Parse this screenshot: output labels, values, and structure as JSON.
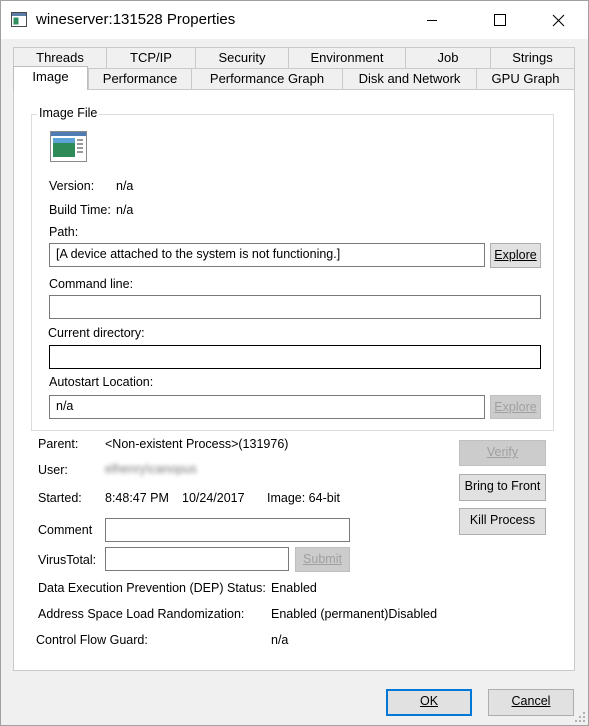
{
  "window": {
    "title": "wineserver:131528 Properties"
  },
  "tabs_row1": [
    "Threads",
    "TCP/IP",
    "Security",
    "Environment",
    "Job",
    "Strings"
  ],
  "tabs_row2": [
    "Image",
    "Performance",
    "Performance Graph",
    "Disk and Network",
    "GPU Graph"
  ],
  "selected_tab": "Image",
  "image_file": {
    "legend": "Image File",
    "version_label": "Version:",
    "version_value": "n/a",
    "build_time_label": "Build Time:",
    "build_time_value": "n/a",
    "path_label": "Path:",
    "path_value": "[A device attached to the system is not functioning.]",
    "explore_label": "Explore",
    "command_line_label": "Command line:",
    "command_line_value": "",
    "current_directory_label": "Current directory:",
    "current_directory_value": "",
    "autostart_label": "Autostart Location:",
    "autostart_value": "n/a",
    "autostart_explore_label": "Explore"
  },
  "details": {
    "parent_label": "Parent:",
    "parent_value": "<Non-existent Process>(131976)",
    "user_label": "User:",
    "user_value": "elhenry\\canopus",
    "started_label": "Started:",
    "started_time": "8:48:47 PM",
    "started_date": "10/24/2017",
    "image_bitness": "Image: 64-bit",
    "comment_label": "Comment",
    "comment_value": "",
    "virustotal_label": "VirusTotal:",
    "virustotal_value": "",
    "submit_label": "Submit",
    "dep_label": "Data Execution Prevention (DEP) Status:",
    "dep_value": "Enabled",
    "aslr_label": "Address Space Load Randomization:",
    "aslr_value": "Enabled (permanent)Disabled",
    "cfg_label": "Control Flow Guard:",
    "cfg_value": "n/a"
  },
  "side_buttons": {
    "verify": "Verify",
    "bring_to_front": "Bring to Front",
    "kill_process": "Kill Process"
  },
  "footer": {
    "ok": "OK",
    "cancel": "Cancel"
  },
  "colors": {
    "accent": "#0078d7",
    "panel": "#ffffff",
    "window": "#f0f0f0"
  }
}
